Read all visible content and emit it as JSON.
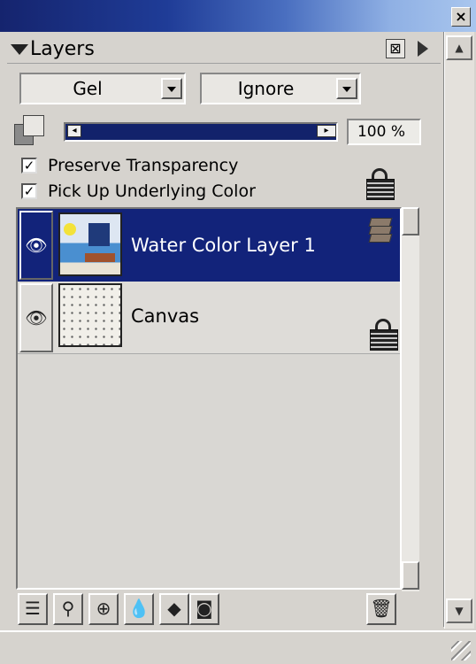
{
  "window": {
    "close_glyph": "×",
    "scroll_up_glyph": "▲",
    "scroll_down_glyph": "▼"
  },
  "palette": {
    "title": "Layers",
    "close_glyph": "⊠",
    "menu_icon": "triangle-right"
  },
  "composite": {
    "method": "Gel",
    "depth": "Ignore"
  },
  "opacity": {
    "value_text": "100 %",
    "value": 100
  },
  "options": {
    "preserve_transparency": {
      "label": "Preserve Transparency",
      "checked": true
    },
    "pick_up_underlying": {
      "label": "Pick Up Underlying Color",
      "checked": true
    }
  },
  "layers": [
    {
      "name": "Water Color Layer 1",
      "selected": true,
      "visible": true
    },
    {
      "name": "Canvas",
      "selected": false,
      "visible": true,
      "locked": true
    }
  ],
  "toolbar": {
    "icons": [
      "layer-adjuster-icon",
      "dynamic-plugin-icon",
      "new-layer-icon",
      "new-watercolor-layer-icon",
      "new-liquid-ink-layer-icon",
      "create-layer-mask-icon",
      "trash-icon"
    ]
  },
  "colors": {
    "title_gradient_start": "#15246e",
    "selection": "#12237a",
    "panel": "#d6d3ce"
  }
}
